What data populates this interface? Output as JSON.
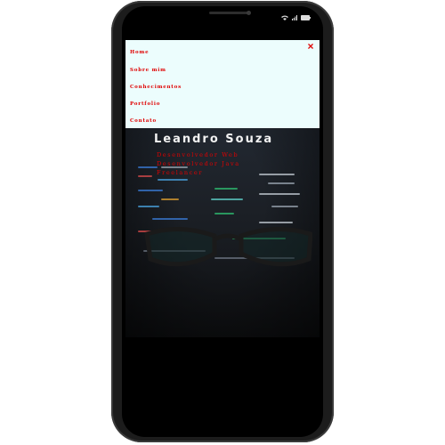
{
  "menu": {
    "items": [
      {
        "label": "Home"
      },
      {
        "label": "Sobre mim"
      },
      {
        "label": "Conhecimentos"
      },
      {
        "label": "Portfolio"
      },
      {
        "label": "Contato"
      }
    ],
    "close_label": "×"
  },
  "hero": {
    "name": "Leandro Souza",
    "roles": [
      "Desenvolvedor Web",
      "Desenvolvedor Java",
      "Freelancer"
    ]
  },
  "icons": {
    "menu_close": "close-icon",
    "status": [
      "wifi-icon",
      "signal-icon",
      "battery-icon"
    ]
  },
  "colors": {
    "accent": "#e00000",
    "menu_background": "#ecfdfd",
    "phone_frame": "#1c1c1c",
    "hero_text": "#f2f2f2"
  }
}
